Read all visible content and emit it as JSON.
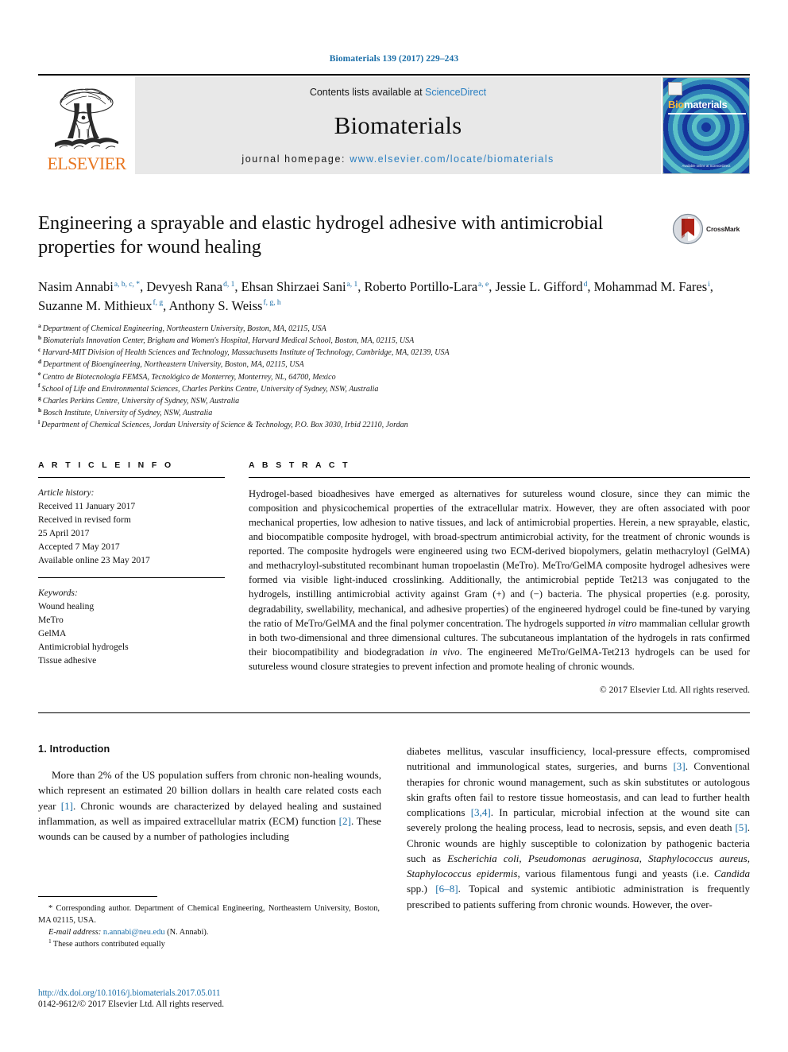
{
  "running_head": "Biomaterials 139 (2017) 229–243",
  "masthead": {
    "publisher_name": "ELSEVIER",
    "contents_prefix": "Contents lists available at ",
    "contents_link": "ScienceDirect",
    "journal_name": "Biomaterials",
    "homepage_prefix": "journal homepage: ",
    "homepage_url": "www.elsevier.com/locate/biomaterials",
    "cover": {
      "title_part1": "Bio",
      "title_part2": "materials",
      "footer": "Available online at\nScienceDirect"
    }
  },
  "article": {
    "title": "Engineering a sprayable and elastic hydrogel adhesive with antimicrobial properties for wound healing",
    "crossmark_label": "CrossMark",
    "authors_line1": "Nasim Annabi",
    "authors": [
      {
        "name": "Nasim Annabi",
        "marks": "a, b, c, *"
      },
      {
        "name": "Devyesh Rana",
        "marks": "d, 1"
      },
      {
        "name": "Ehsan Shirzaei Sani",
        "marks": "a, 1"
      },
      {
        "name": "Roberto Portillo-Lara",
        "marks": "a, e"
      },
      {
        "name": "Jessie L. Gifford",
        "marks": "d"
      },
      {
        "name": "Mohammad M. Fares",
        "marks": "i"
      },
      {
        "name": "Suzanne M. Mithieux",
        "marks": "f, g"
      },
      {
        "name": "Anthony S. Weiss",
        "marks": "f, g, h"
      }
    ],
    "affiliations": [
      {
        "mark": "a",
        "text": "Department of Chemical Engineering, Northeastern University, Boston, MA, 02115, USA"
      },
      {
        "mark": "b",
        "text": "Biomaterials Innovation Center, Brigham and Women's Hospital, Harvard Medical School, Boston, MA, 02115, USA"
      },
      {
        "mark": "c",
        "text": "Harvard-MIT Division of Health Sciences and Technology, Massachusetts Institute of Technology, Cambridge, MA, 02139, USA"
      },
      {
        "mark": "d",
        "text": "Department of Bioengineering, Northeastern University, Boston, MA, 02115, USA"
      },
      {
        "mark": "e",
        "text": "Centro de Biotecnología FEMSA, Tecnológico de Monterrey, Monterrey, NL, 64700, Mexico"
      },
      {
        "mark": "f",
        "text": "School of Life and Environmental Sciences, Charles Perkins Centre, University of Sydney, NSW, Australia"
      },
      {
        "mark": "g",
        "text": "Charles Perkins Centre, University of Sydney, NSW, Australia"
      },
      {
        "mark": "h",
        "text": "Bosch Institute, University of Sydney, NSW, Australia"
      },
      {
        "mark": "i",
        "text": "Department of Chemical Sciences, Jordan University of Science & Technology, P.O. Box 3030, Irbid 22110, Jordan"
      }
    ]
  },
  "article_info": {
    "heading": "A R T I C L E   I N F O",
    "history_label": "Article history:",
    "history": [
      "Received 11 January 2017",
      "Received in revised form",
      "25 April 2017",
      "Accepted 7 May 2017",
      "Available online 23 May 2017"
    ],
    "keywords_label": "Keywords:",
    "keywords": [
      "Wound healing",
      "MeTro",
      "GelMA",
      "Antimicrobial hydrogels",
      "Tissue adhesive"
    ]
  },
  "abstract": {
    "heading": "A B S T R A C T",
    "part1": "Hydrogel-based bioadhesives have emerged as alternatives for sutureless wound closure, since they can mimic the composition and physicochemical properties of the extracellular matrix. However, they are often associated with poor mechanical properties, low adhesion to native tissues, and lack of antimicrobial properties. Herein, a new sprayable, elastic, and biocompatible composite hydrogel, with broad-spectrum antimicrobial activity, for the treatment of chronic wounds is reported. The composite hydrogels were engineered using two ECM-derived biopolymers, gelatin methacryloyl (GelMA) and methacryloyl-substituted recombinant human tropoelastin (MeTro). MeTro/GelMA composite hydrogel adhesives were formed via visible light-induced crosslinking. Additionally, the antimicrobial peptide Tet213 was conjugated to the hydrogels, instilling antimicrobial activity against Gram (+) and (−) bacteria. The physical properties (e.g. porosity, degradability, swellability, mechanical, and adhesive properties) of the engineered hydrogel could be fine-tuned by varying the ratio of MeTro/GelMA and the final polymer concentration. The hydrogels supported ",
    "italic1": "in vitro",
    "part2": " mammalian cellular growth in both two-dimensional and three dimensional cultures. The subcutaneous implantation of the hydrogels in rats confirmed their biocompatibility and biodegradation ",
    "italic2": "in vivo",
    "part3": ". The engineered MeTro/GelMA-Tet213 hydrogels can be used for sutureless wound closure strategies to prevent infection and promote healing of chronic wounds.",
    "copyright": "© 2017 Elsevier Ltd. All rights reserved."
  },
  "introduction": {
    "heading": "1.  Introduction",
    "left_part1": "More than 2% of the US population suffers from chronic non-healing wounds, which represent an estimated 20 billion dollars in health care related costs each year ",
    "left_ref1": "[1]",
    "left_part2": ". Chronic wounds are characterized by delayed healing and sustained inflammation, as well as impaired extracellular matrix (ECM) function ",
    "left_ref2": "[2]",
    "left_part3": ". These wounds can be caused by a number of pathologies including",
    "right_part1": "diabetes mellitus, vascular insufficiency, local-pressure effects, compromised nutritional and immunological states, surgeries, and burns ",
    "right_ref1": "[3]",
    "right_part2": ". Conventional therapies for chronic wound management, such as skin substitutes or autologous skin grafts often fail to restore tissue homeostasis, and can lead to further health complications ",
    "right_ref2": "[3,4]",
    "right_part3": ". In particular, microbial infection at the wound site can severely prolong the healing process, lead to necrosis, sepsis, and even death ",
    "right_ref3": "[5]",
    "right_part4": ". Chronic wounds are highly susceptible to colonization by pathogenic bacteria such as ",
    "right_it1": "Escherichia coli, Pseudomonas aeruginosa, Staphylococcus aureus, Staphylococcus epidermis",
    "right_part5": ", various filamentous fungi and yeasts (i.e. ",
    "right_it2": "Candida",
    "right_part6": " spp.) ",
    "right_ref4": "[6–8]",
    "right_part7": ". Topical and systemic antibiotic administration is frequently prescribed to patients suffering from chronic wounds. However, the over-"
  },
  "footnotes": {
    "corresponding": "* Corresponding author. Department of Chemical Engineering, Northeastern University, Boston, MA 02115, USA.",
    "email_label": "E-mail address:",
    "email": "n.annabi@neu.edu",
    "email_suffix": " (N. Annabi).",
    "equal_mark": "1",
    "equal_contrib": "These authors contributed equally"
  },
  "doi_block": {
    "doi": "http://dx.doi.org/10.1016/j.biomaterials.2017.05.011",
    "issn_line": "0142-9612/© 2017 Elsevier Ltd. All rights reserved."
  },
  "colors": {
    "link_blue": "#1a6ea8",
    "elsevier_orange": "#E87722",
    "masthead_gray": "#e8e8e8"
  }
}
